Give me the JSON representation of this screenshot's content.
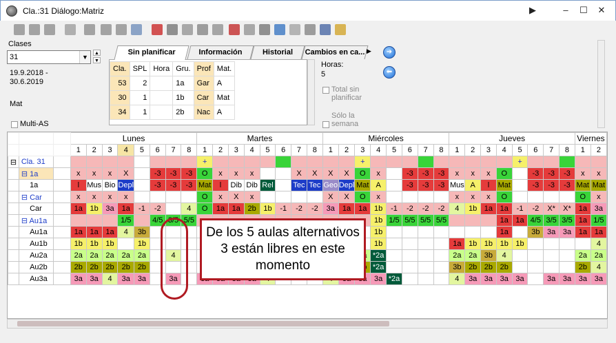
{
  "window": {
    "title": "Cla.:31  Diálogo:Matriz"
  },
  "left_panel": {
    "clases_label": "Clases",
    "class_value": "31",
    "date_from": "19.9.2018 -",
    "date_to": "30.6.2019",
    "subject": "Mat",
    "multi_as": "Multi-AS"
  },
  "tabs": [
    {
      "label": "Sin planificar"
    },
    {
      "label": "Información"
    },
    {
      "label": "Historial"
    },
    {
      "label": "Cambios en ca..."
    }
  ],
  "subtable": {
    "headers": [
      "Cla.",
      "SPL",
      "Hora",
      "Gru.",
      "Prof",
      "Mat."
    ],
    "rows": [
      [
        "53",
        "2",
        "",
        "1a",
        "Gar",
        "A"
      ],
      [
        "30",
        "1",
        "",
        "1b",
        "Car",
        "Mat"
      ],
      [
        "34",
        "1",
        "",
        "2b",
        "Nac",
        "A"
      ]
    ]
  },
  "hours": {
    "label": "Horas:",
    "value": "5",
    "total_label": "Total sin planificar",
    "only_week_label": "Sólo la semana"
  },
  "days": [
    "Lunes",
    "Martes",
    "Miércoles",
    "Jueves",
    "Viernes"
  ],
  "periods": [
    "1",
    "2",
    "3",
    "4",
    "5",
    "6",
    "7",
    "8"
  ],
  "grid_rows": [
    {
      "label": "Cla. 31",
      "indent": 0,
      "tree": "⊟",
      "kind": "class"
    },
    {
      "label": "1a",
      "indent": 1,
      "tree": "⊟",
      "kind": "group"
    },
    {
      "label": "1a",
      "indent": 2,
      "tree": "",
      "kind": "detail"
    },
    {
      "label": "Car",
      "indent": 1,
      "tree": "⊟",
      "kind": "group"
    },
    {
      "label": "Car",
      "indent": 2,
      "tree": "",
      "kind": "detail"
    },
    {
      "label": "Au1a",
      "indent": 1,
      "tree": "⊟",
      "kind": "group"
    },
    {
      "label": "Au1a",
      "indent": 2,
      "tree": "",
      "kind": "detail"
    },
    {
      "label": "Au1b",
      "indent": 2,
      "tree": "",
      "kind": "detail"
    },
    {
      "label": "Au2a",
      "indent": 2,
      "tree": "",
      "kind": "detail"
    },
    {
      "label": "Au2b",
      "indent": 2,
      "tree": "",
      "kind": "detail"
    },
    {
      "label": "Au3a",
      "indent": 2,
      "tree": "",
      "kind": "detail"
    }
  ],
  "cells": [
    [
      "",
      "",
      "",
      "",
      "",
      "",
      "",
      "",
      "+",
      "",
      "",
      "",
      "",
      "",
      "",
      "",
      "",
      "",
      "+",
      "",
      "",
      "",
      "",
      "",
      "",
      "",
      "",
      "",
      "+",
      "",
      "",
      "",
      "",
      "",
      "",
      "",
      "",
      "",
      "+",
      ""
    ],
    [
      "x",
      "x",
      "x",
      "X",
      "",
      "-3",
      "-3",
      "-3",
      "O",
      "x",
      "x",
      "x",
      "",
      "",
      "X",
      "X",
      "X",
      "X",
      "O",
      "x",
      "",
      "-3",
      "-3",
      "-3",
      "x",
      "x",
      "x",
      "O",
      "",
      "-3",
      "-3",
      "-3",
      "x",
      "x"
    ],
    [
      "l",
      "Mus",
      "Bio",
      "Depl",
      "",
      "-3",
      "-3",
      "-3",
      "Mat",
      "l",
      "Dib",
      "Dib",
      "Rel",
      "",
      "Tec",
      "Tec",
      "Geo",
      "Depl",
      "Mat",
      "A",
      "",
      "-3",
      "-3",
      "-3",
      "Mus",
      "A",
      "l",
      "Mat",
      "",
      "-3",
      "-3",
      "-3",
      "Mat",
      "Mat"
    ],
    [
      "x",
      "x",
      "x",
      "x",
      "",
      "",
      "",
      "",
      "O",
      "x",
      "X",
      "x",
      "",
      "",
      "",
      "",
      "X",
      "X",
      "O",
      "x",
      "",
      "",
      "",
      "",
      "x",
      "x",
      "x",
      "O",
      "",
      "",
      "",
      "",
      "O",
      "x"
    ],
    [
      "1a",
      "1b",
      "3a",
      "1a",
      "-1",
      "-2",
      "",
      "4",
      "O",
      "1a",
      "1a",
      "2b",
      "1b",
      "-1",
      "-2",
      "-2",
      "3a",
      "1a",
      "1a",
      "1b",
      "-1",
      "-2",
      "-2",
      "-2",
      "4",
      "1b",
      "1a",
      "1a",
      "-1",
      "-2",
      "X*",
      "X*",
      "1a",
      "3a"
    ],
    [
      "",
      "",
      "",
      "1/5",
      "",
      "4/5",
      "3/5",
      "5/5",
      "",
      "",
      "",
      "",
      "",
      "",
      "",
      "",
      "",
      "",
      "",
      "1b",
      "1/5",
      "5/5",
      "5/5",
      "5/5",
      "",
      "",
      "",
      "1a",
      "1a",
      "4/5",
      "3/5",
      "3/5",
      "1a",
      "1/5"
    ],
    [
      "1a",
      "1a",
      "1a",
      "4",
      "3b",
      "",
      "",
      "",
      "",
      "",
      "",
      "",
      "",
      "",
      "",
      "",
      "",
      "",
      "",
      "1b",
      "",
      "",
      "",
      "",
      "",
      "",
      "",
      "1a",
      "",
      "3b",
      "3a",
      "3a",
      "1a",
      "1a"
    ],
    [
      "1b",
      "1b",
      "1b",
      "",
      "1b",
      "",
      "",
      "",
      "",
      "",
      "",
      "",
      "",
      "",
      "",
      "",
      "",
      "",
      "",
      "1b",
      "",
      "",
      "",
      "",
      "1a",
      "1b",
      "1b",
      "1b",
      "1b",
      "",
      "",
      "",
      "",
      "4"
    ],
    [
      "2a",
      "2a",
      "2a",
      "2a",
      "2a",
      "",
      "4",
      "",
      "",
      "",
      "",
      "",
      "",
      "",
      "",
      "",
      "",
      "",
      "2a",
      "*2a",
      "",
      "",
      "",
      "",
      "2a",
      "2a",
      "3b",
      "4",
      "",
      "",
      "",
      "",
      "2a",
      "2a"
    ],
    [
      "2b",
      "2b",
      "2b",
      "2b",
      "2b",
      "",
      "",
      "",
      "",
      "",
      "",
      "",
      "",
      "",
      "",
      "",
      "",
      "",
      "2b",
      "*2a",
      "",
      "",
      "",
      "",
      "3b",
      "2b",
      "2b",
      "2b",
      "",
      "",
      "",
      "",
      "2b",
      "4"
    ],
    [
      "3a",
      "3a",
      "4",
      "3a",
      "3a",
      "",
      "3a",
      "",
      "3a",
      "3a",
      "3a",
      "3a",
      "4",
      "",
      "",
      "",
      "4",
      "3a",
      "3a",
      "3a",
      "*2a",
      "",
      "",
      "",
      "4",
      "3a",
      "3a",
      "3a",
      "3a",
      "",
      "3a",
      "3a",
      "3a",
      "3a"
    ]
  ],
  "callout": {
    "text": "De los 5 aulas alternativos 3 están libres en este momento"
  },
  "colors": {
    "pink": "#f6b8b8",
    "red": "#e53b3b",
    "green": "#39d439",
    "yellow": "#f6f06a",
    "olive": "#a9a900",
    "darkgreen": "#005a3a",
    "blue": "#1c3cc8",
    "purple": "#9a8cc8",
    "callout_border": "#b01a22"
  }
}
